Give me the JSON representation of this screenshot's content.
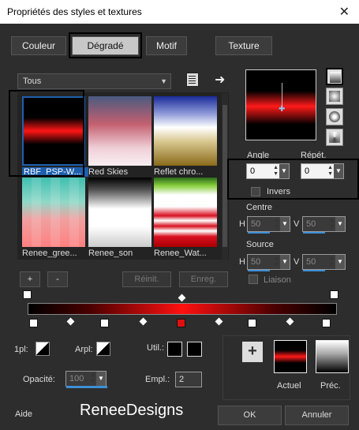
{
  "window": {
    "title": "Propriétés des styles et textures",
    "close": "✕"
  },
  "tabs": [
    {
      "label": "Couleur",
      "active": false
    },
    {
      "label": "Dégradé",
      "active": true
    },
    {
      "label": "Motif",
      "active": false
    },
    {
      "label": "Texture",
      "active": false
    }
  ],
  "library": {
    "category": "Tous",
    "gradients": [
      {
        "label": "RBF_PSP-W...",
        "selected": true
      },
      {
        "label": "Red Skies",
        "selected": false
      },
      {
        "label": "Reflet chro...",
        "selected": false
      },
      {
        "label": "Renee_gree...",
        "selected": false
      },
      {
        "label": "Renee_son",
        "selected": false
      },
      {
        "label": "Renee_Wat...",
        "selected": false
      }
    ],
    "add": "+",
    "remove": "-",
    "reset": "Réinit.",
    "save": "Enreg."
  },
  "angle": {
    "label": "Angle",
    "value": "0"
  },
  "repeat": {
    "label": "Répét.",
    "value": "0"
  },
  "invert": {
    "label": "Invers",
    "checked": false
  },
  "center": {
    "label": "Centre",
    "h_label": "H",
    "h": "50",
    "v_label": "V",
    "v": "50"
  },
  "source": {
    "label": "Source",
    "h_label": "H",
    "h": "50",
    "v_label": "V",
    "v": "50"
  },
  "link": {
    "label": "Liaison",
    "checked": false
  },
  "stop_controls": {
    "first_label": "1pl:",
    "arpl_label": "Arpl:",
    "util_label": "Util.:",
    "opacity_label": "Opacité:",
    "opacity_value": "100",
    "empl_label": "Empl.:",
    "empl_value": "2"
  },
  "swatches": {
    "current": "Actuel",
    "previous": "Préc."
  },
  "footer": {
    "help": "Aide",
    "watermark": "ReneeDesigns",
    "ok": "OK",
    "cancel": "Annuler"
  },
  "colors": {
    "accent": "#1e5fad",
    "red": "#ff1a1a",
    "bg": "#2d2d2d"
  }
}
